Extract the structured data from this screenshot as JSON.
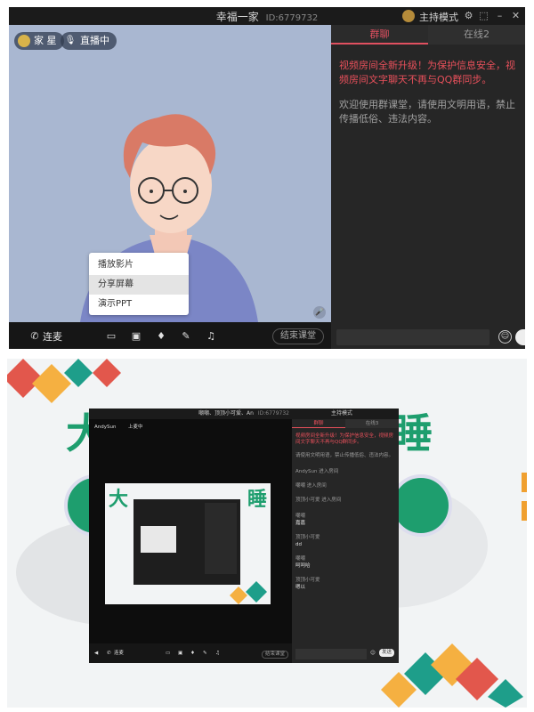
{
  "top": {
    "window_title": "幸福一家",
    "room_id": "ID:6779732",
    "host_mode": "主持模式",
    "members_pill": "家 星",
    "live_pill": "直播中",
    "popup_menu": [
      "播放影片",
      "分享屏幕",
      "演示PPT"
    ],
    "popup_selected_index": 1,
    "bottom_bar": {
      "mic_link": "连麦",
      "end_class": "结束课堂"
    },
    "chat": {
      "tab_group": "群聊",
      "tab_online": "在线2",
      "notice_red": "视频房间全新升级！为保护信息安全，视频房间文字聊天不再与QQ群同步。",
      "notice_grey": "欢迎使用群课堂，请使用文明用语，禁止传播低俗、违法内容。"
    }
  },
  "bottom": {
    "inner_title": "嘲嘲、顶顶小可爱、An",
    "inner_room_id": "ID:6779732",
    "inner_host_mode": "主持模式",
    "inner_user": "AndySun",
    "inner_live": "上麦中",
    "inner_tab_group": "群聊",
    "inner_tab_online": "在线3",
    "inner_notice_red": "视频房间全新升级！为保护信息安全，视频房间文字聊天不再与QQ群同步。",
    "inner_notice_grey": "请使用文明用语，禁止传播低俗、违法内容。",
    "messages": [
      {
        "name": "",
        "text": "AndySun 进入房间"
      },
      {
        "name": "",
        "text": "嘲嘲 进入房间"
      },
      {
        "name": "",
        "text": "顶顶小可爱 进入房间"
      },
      {
        "name": "嘲嘲",
        "text": "嘉嘉"
      },
      {
        "name": "顶顶小可爱",
        "text": "dd"
      },
      {
        "name": "嘲嘲",
        "text": "呵呵哈"
      },
      {
        "name": "顶顶小可爱",
        "text": "嗯以"
      }
    ],
    "inner_mic_link": "连麦",
    "inner_end_class": "结束课堂",
    "inner_send": "发送"
  },
  "colors": {
    "accent_red": "#e8505b",
    "banner_green": "#1e9e6e",
    "panel_dark": "#262626"
  }
}
